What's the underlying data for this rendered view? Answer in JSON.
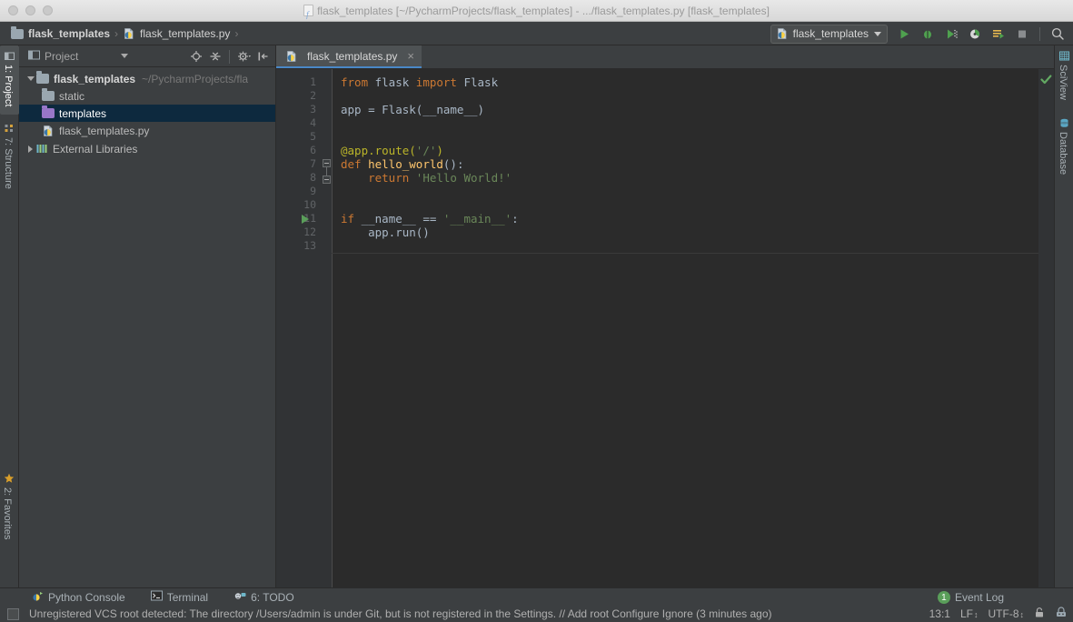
{
  "window": {
    "title": "flask_templates [~/PycharmProjects/flask_templates] - .../flask_templates.py [flask_templates]",
    "doc_icon": "python-file-icon"
  },
  "navbar": {
    "crumbs": [
      {
        "label": "flask_templates",
        "icon": "folder-icon"
      },
      {
        "label": "flask_templates.py",
        "icon": "python-file-icon"
      }
    ],
    "separator": "›",
    "run_config": {
      "label": "flask_templates",
      "icon": "python-file-icon",
      "caret": "chevron-down-icon"
    },
    "buttons": [
      {
        "name": "run-button",
        "icon": "run-icon"
      },
      {
        "name": "debug-button",
        "icon": "debug-icon"
      },
      {
        "name": "run-coverage-button",
        "icon": "coverage-icon"
      },
      {
        "name": "profile-button",
        "icon": "profile-icon"
      },
      {
        "name": "run-with-console-button",
        "icon": "console-run-icon"
      },
      {
        "name": "stop-button",
        "icon": "stop-icon"
      },
      {
        "name": "search-everywhere-button",
        "icon": "search-icon"
      }
    ]
  },
  "left_strip": {
    "tabs": [
      {
        "label": "1: Project",
        "mnemonic": "1",
        "active": true,
        "icon": "project-icon"
      },
      {
        "label": "7: Structure",
        "mnemonic": "7",
        "active": false,
        "icon": "structure-icon"
      },
      {
        "label": "2: Favorites",
        "mnemonic": "2",
        "active": false,
        "icon": "star-icon"
      }
    ]
  },
  "right_strip": {
    "tabs": [
      {
        "label": "SciView",
        "icon": "sciview-icon"
      },
      {
        "label": "Database",
        "icon": "database-icon"
      }
    ]
  },
  "project_panel": {
    "title": "Project",
    "title_icon": "project-view-icon",
    "tools": [
      {
        "name": "select-opened-file-button",
        "icon": "target-icon"
      },
      {
        "name": "collapse-all-button",
        "icon": "collapse-all-icon"
      },
      {
        "name": "settings-button",
        "icon": "gear-icon"
      },
      {
        "name": "hide-button",
        "icon": "hide-panel-icon"
      }
    ],
    "tree": [
      {
        "label": "flask_templates",
        "path": "~/PycharmProjects/fla",
        "icon": "folder-icon",
        "expander": "expanded",
        "indent": 0,
        "bold": true,
        "selected": false
      },
      {
        "label": "static",
        "path": "",
        "icon": "folder-icon",
        "expander": "none",
        "indent": 1,
        "bold": false,
        "selected": false
      },
      {
        "label": "templates",
        "path": "",
        "icon": "folder-violet-icon",
        "expander": "none",
        "indent": 1,
        "bold": false,
        "selected": true
      },
      {
        "label": "flask_templates.py",
        "path": "",
        "icon": "python-file-icon",
        "expander": "none",
        "indent": 1,
        "bold": false,
        "selected": false
      },
      {
        "label": "External Libraries",
        "path": "",
        "icon": "library-icon",
        "expander": "collapsed",
        "indent": 0,
        "bold": false,
        "selected": false
      }
    ]
  },
  "editor": {
    "tabs": [
      {
        "label": "flask_templates.py",
        "icon": "python-file-icon",
        "close": "×",
        "active": true
      }
    ],
    "inspection_status": "ok-check-icon",
    "line_numbers": [
      "1",
      "2",
      "3",
      "4",
      "5",
      "6",
      "7",
      "8",
      "9",
      "10",
      "11",
      "12",
      "13"
    ],
    "lines": [
      {
        "n": 1,
        "tokens": [
          {
            "t": "from",
            "c": "kw"
          },
          {
            "t": " flask ",
            "c": "def"
          },
          {
            "t": "import",
            "c": "kw"
          },
          {
            "t": " Flask",
            "c": "cls"
          }
        ]
      },
      {
        "n": 2,
        "tokens": []
      },
      {
        "n": 3,
        "tokens": [
          {
            "t": "app = Flask(__name__)",
            "c": "def"
          }
        ]
      },
      {
        "n": 4,
        "tokens": []
      },
      {
        "n": 5,
        "tokens": []
      },
      {
        "n": 6,
        "tokens": [
          {
            "t": "@app.route(",
            "c": "dec"
          },
          {
            "t": "'/'",
            "c": "str"
          },
          {
            "t": ")",
            "c": "dec"
          }
        ]
      },
      {
        "n": 7,
        "tokens": [
          {
            "t": "def",
            "c": "kw"
          },
          {
            "t": " ",
            "c": "def"
          },
          {
            "t": "hello_world",
            "c": "fn"
          },
          {
            "t": "():",
            "c": "def"
          }
        ]
      },
      {
        "n": 8,
        "tokens": [
          {
            "t": "    ",
            "c": "def"
          },
          {
            "t": "return",
            "c": "kw"
          },
          {
            "t": " ",
            "c": "def"
          },
          {
            "t": "'Hello World!'",
            "c": "str"
          }
        ]
      },
      {
        "n": 9,
        "tokens": []
      },
      {
        "n": 10,
        "tokens": []
      },
      {
        "n": 11,
        "tokens": [
          {
            "t": "if",
            "c": "kw"
          },
          {
            "t": " __name__ == ",
            "c": "def"
          },
          {
            "t": "'__main__'",
            "c": "str"
          },
          {
            "t": ":",
            "c": "def"
          }
        ]
      },
      {
        "n": 12,
        "tokens": [
          {
            "t": "    app.run()",
            "c": "def"
          }
        ]
      },
      {
        "n": 13,
        "tokens": []
      }
    ],
    "run_marker_line": 11,
    "fold_lines": [
      7,
      8
    ]
  },
  "bottom_strip": {
    "tabs": [
      {
        "label": "Python Console",
        "icon": "python-console-icon",
        "mnemonic": ""
      },
      {
        "label": "Terminal",
        "icon": "terminal-icon",
        "mnemonic": ""
      },
      {
        "label": "6: TODO",
        "icon": "todo-icon",
        "mnemonic": "6"
      }
    ],
    "event_log": {
      "label": "Event Log",
      "count": "1"
    }
  },
  "statusbar": {
    "message": "Unregistered VCS root detected: The directory /Users/admin is under Git, but is not registered in the Settings. // Add root  Configure  Ignore (3 minutes ago)",
    "caret_position": "13:1",
    "line_separator": "LF",
    "encoding": "UTF-8",
    "lock_icon": "lock-icon",
    "inspections_icon": "hector-icon"
  },
  "colors": {
    "chrome": "#3c3f41",
    "editor_bg": "#2b2b2b",
    "gutter_bg": "#313335",
    "selection": "#0d293e",
    "tab_underline": "#4a88c7",
    "keyword": "#cc7832",
    "string": "#6a8759",
    "decorator": "#bbb529",
    "function": "#ffc66d",
    "text": "#a9b7c6",
    "accent_green": "#5a9e5a"
  }
}
